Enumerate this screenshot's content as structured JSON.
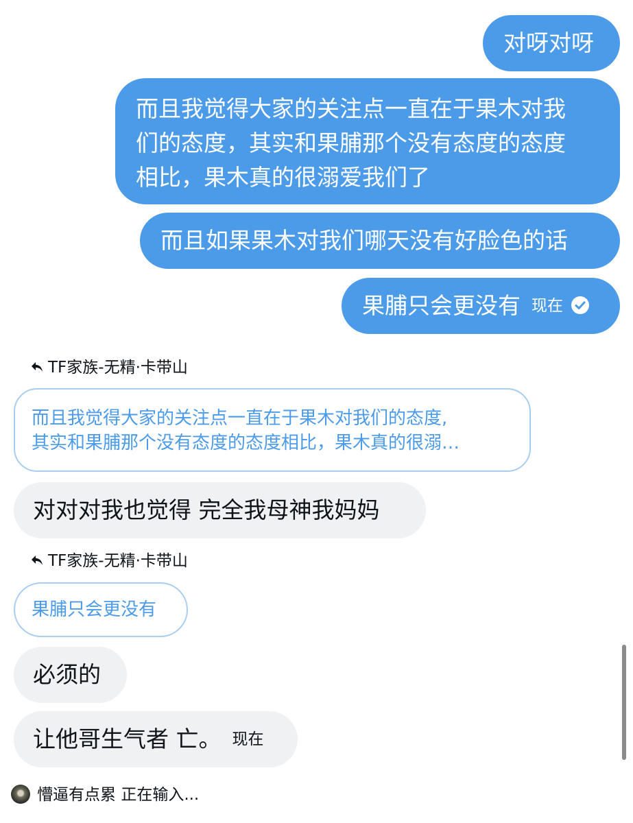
{
  "messages_sent": [
    {
      "text": "对呀对呀"
    },
    {
      "lines": [
        "而且我觉得大家的关注点一直在于果木对我",
        "们的态度，其实和果脯那个没有态度的态度",
        "相比，果木真的很溺爱我们了"
      ]
    },
    {
      "text": "而且如果果木对我们哪天没有好脸色的话"
    },
    {
      "text": "果脯只会更没有",
      "time": "现在"
    }
  ],
  "reply_1": {
    "label": "TF家族-无精·卡带山",
    "quote_lines": [
      "而且我觉得大家的关注点一直在于果木对我们的态度,",
      "其实和果脯那个没有态度的态度相比，果木真的很溺…"
    ],
    "message": "对对对我也觉得 完全我母神我妈妈"
  },
  "reply_2": {
    "label": "TF家族-无精·卡带山",
    "quote": "果脯只会更没有"
  },
  "messages_received": [
    {
      "text": "必须的"
    },
    {
      "text": "让他哥生气者 亡。",
      "time": "现在"
    }
  ],
  "typing_indicator": {
    "name": "懵逼有点累",
    "status": "正在输入..."
  },
  "colors": {
    "sent_bubble": "#4c9be8",
    "received_bubble": "#eff1f3",
    "quote_border": "#a7cdf3",
    "quote_text": "#4c9be8"
  },
  "icons": {
    "reply": "reply-arrow-icon",
    "read": "check-circle-icon"
  }
}
